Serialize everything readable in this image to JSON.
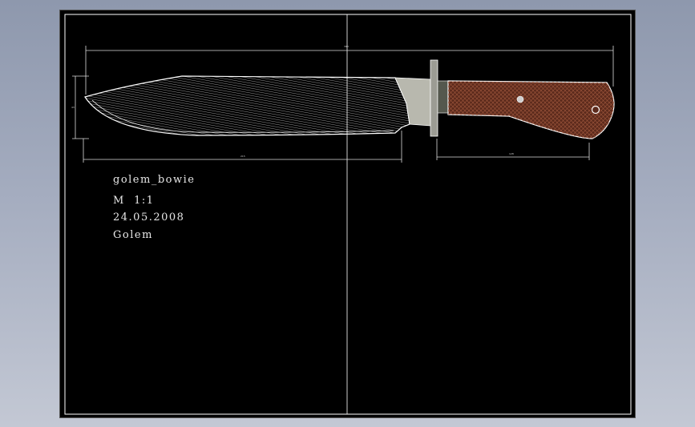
{
  "notes": {
    "name": "golem_bowie",
    "scale": "M  1:1",
    "date": "24.05.2008",
    "author": "Golem"
  },
  "dimensions": {
    "overall": "394",
    "blade_length": "215",
    "handle_length": "128",
    "blade_height": "43"
  },
  "colors": {
    "sheet": "#000000",
    "frame": "#ffffff",
    "blade_hatch": "#d8d8d8",
    "guard": "#9c9c94",
    "handle": "#5c2a1c",
    "handle_hatch": "#a0583c"
  }
}
